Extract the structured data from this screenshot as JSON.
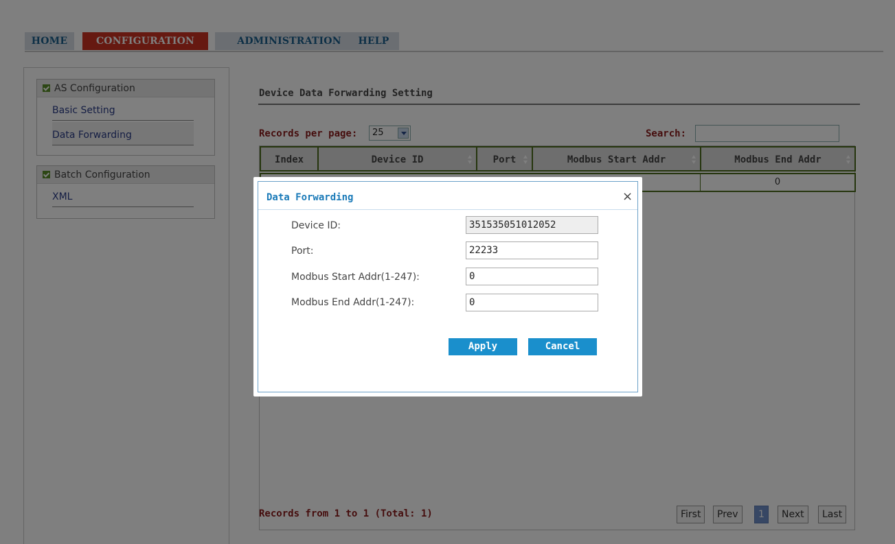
{
  "nav": {
    "tabs": [
      {
        "label": "HOME"
      },
      {
        "label": "CONFIGURATION"
      },
      {
        "label": "ADMINISTRATION"
      },
      {
        "label": "HELP"
      }
    ]
  },
  "sidebar": {
    "groups": [
      {
        "title": "AS Configuration",
        "items": [
          {
            "label": "Basic Setting"
          },
          {
            "label": "Data Forwarding"
          }
        ]
      },
      {
        "title": "Batch Configuration",
        "items": [
          {
            "label": "XML"
          }
        ]
      }
    ]
  },
  "main": {
    "title": "Device Data Forwarding Setting",
    "records_per_page_label": "Records per page:",
    "records_per_page_value": "25",
    "search_label": "Search:",
    "search_value": "",
    "columns": [
      "Index",
      "Device ID",
      "Port",
      "Modbus Start Addr",
      "Modbus End Addr"
    ],
    "rows": [
      {
        "end_addr": "0"
      }
    ],
    "footer_text": "Records from 1 to 1 (Total: 1)",
    "pager": {
      "first": "First",
      "prev": "Prev",
      "current": "1",
      "next": "Next",
      "last": "Last"
    }
  },
  "modal": {
    "title": "Data Forwarding",
    "close_glyph": "×",
    "fields": [
      {
        "label": "Device ID:",
        "value": "351535051012052"
      },
      {
        "label": "Port:",
        "value": "22233"
      },
      {
        "label": "Modbus Start Addr(1-247):",
        "value": "0"
      },
      {
        "label": "Modbus End Addr(1-247):",
        "value": "0"
      }
    ],
    "apply_label": "Apply",
    "cancel_label": "Cancel"
  },
  "colors": {
    "active_tab": "#cc3322",
    "tab_text": "#1a5f8c",
    "accent_button": "#1a8fcc",
    "label_red": "#8b1a1a",
    "table_border": "#4a6a1a"
  }
}
